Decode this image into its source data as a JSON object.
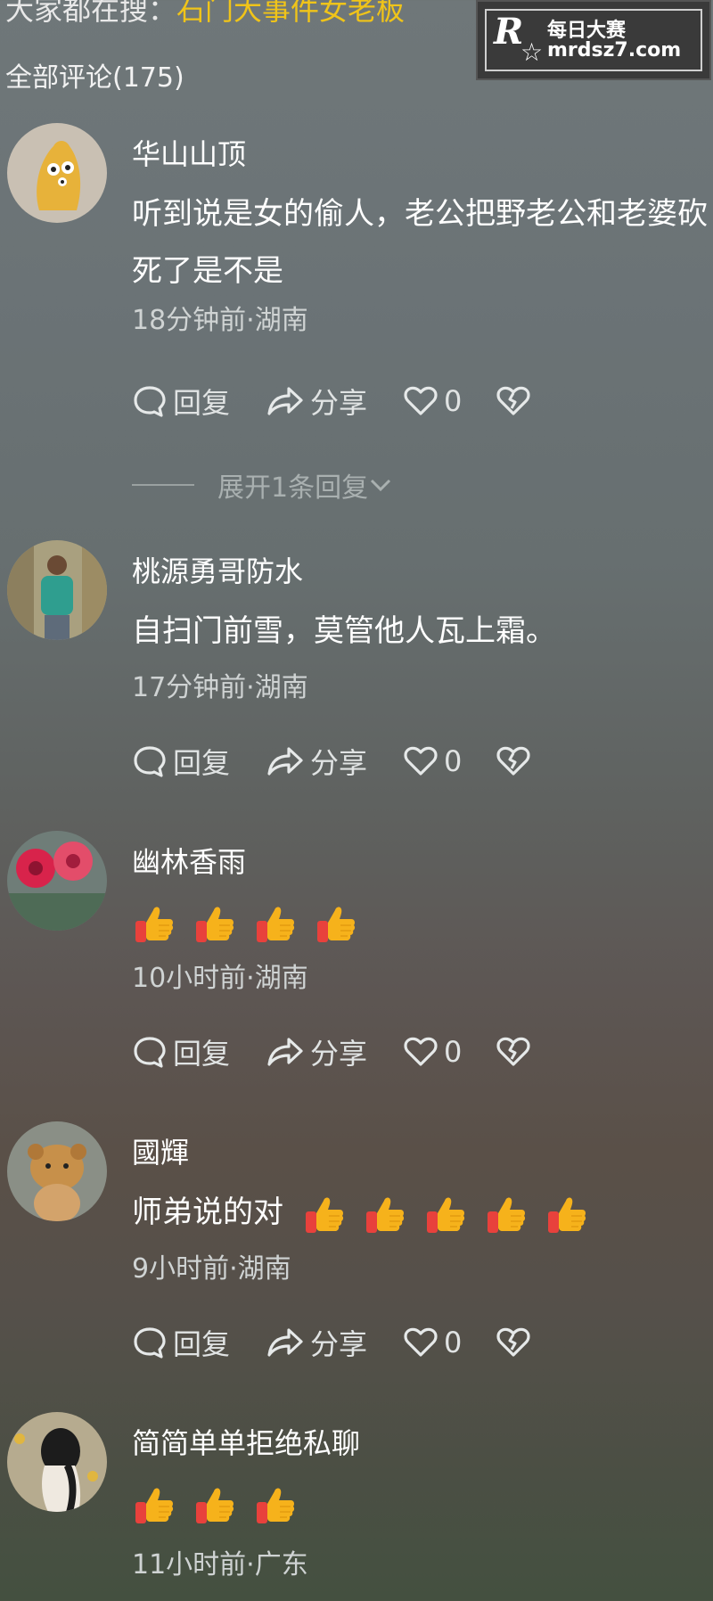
{
  "header": {
    "search_prefix": "大家都在搜：",
    "search_keyword": "石门大事件女老板",
    "comment_count": "全部评论(175)"
  },
  "watermark": {
    "logo": "R",
    "title": "每日大赛",
    "url": "mrdsz7.com"
  },
  "comments": [
    {
      "user": "华山山顶",
      "text": "听到说是女的偷人，老公把野老公和老婆砍死了是不是",
      "meta": "18分钟前·湖南",
      "reply_label": "回复",
      "share_label": "分享",
      "likes": "0",
      "expand": "展开1条回复"
    },
    {
      "user": "桃源勇哥防水",
      "text": "自扫门前雪，莫管他人瓦上霜。",
      "meta": "17分钟前·湖南",
      "reply_label": "回复",
      "share_label": "分享",
      "likes": "0"
    },
    {
      "user": "幽林香雨",
      "text": "",
      "thumbs": 4,
      "meta": "10小时前·湖南",
      "reply_label": "回复",
      "share_label": "分享",
      "likes": "0"
    },
    {
      "user": "國輝",
      "text": "师弟说的对",
      "thumbs": 5,
      "meta": "9小时前·湖南",
      "reply_label": "回复",
      "share_label": "分享",
      "likes": "0"
    },
    {
      "user": "简简单单拒绝私聊",
      "text": "",
      "thumbs": 3,
      "meta": "11小时前·广东"
    }
  ],
  "colors": {
    "keyword": "#f0c419",
    "thumb": "#f6b21b",
    "sleeve": "#e8413c"
  },
  "icons": [
    "reply-icon",
    "share-icon",
    "heart-icon",
    "dislike-icon",
    "chevron-down-icon",
    "thumbs-up-icon"
  ]
}
